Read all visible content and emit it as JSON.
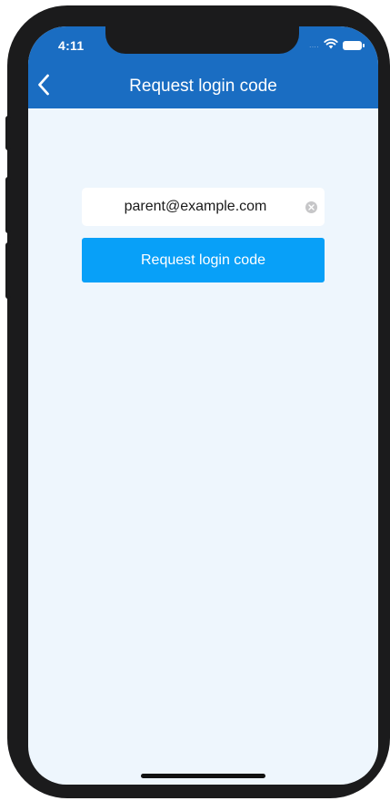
{
  "status_bar": {
    "time": "4:11",
    "signal_dots": "....",
    "icons": [
      "wifi-icon",
      "battery-icon"
    ]
  },
  "nav": {
    "back_icon": "chevron-left-icon",
    "title": "Request login code"
  },
  "form": {
    "email_value": "parent@example.com",
    "clear_icon": "clear-circle-icon",
    "submit_label": "Request login code"
  },
  "colors": {
    "header": "#1a6dc2",
    "background": "#eef6fd",
    "button": "#08a0f8",
    "device_frame": "#1b1b1c"
  }
}
